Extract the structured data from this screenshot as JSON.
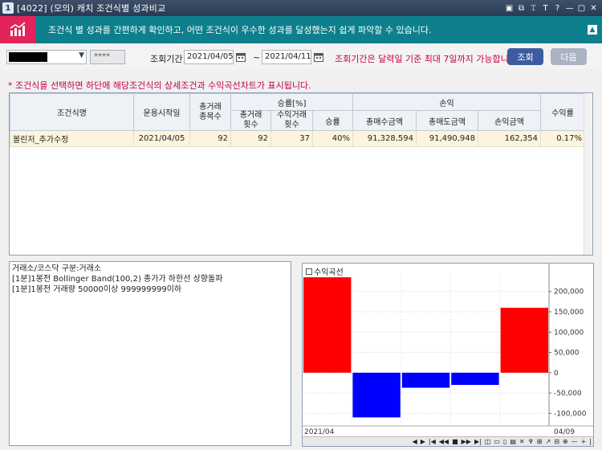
{
  "window": {
    "title": "[4022] (모의) 캐치 조건식별 성과비교",
    "controls": [
      "▣",
      "⧉",
      "𝚃",
      "T",
      "?",
      "—",
      "▢",
      "✕"
    ]
  },
  "banner": {
    "text": "조건식 별 성과를 간편하게 확인하고, 어떤 조건식이 우수한 성과를 달성했는지 쉽게 파악할 수 있습니다.",
    "collapse": "▲"
  },
  "query": {
    "account_mask": "****",
    "period_label": "조회기간",
    "start_date": "2021/04/05",
    "end_date": "2021/04/11",
    "tilde": "~",
    "notice": "조회기간은 달력일 기준 최대 7일까지 가능합니다.",
    "query_button": "조회",
    "next_button": "다음"
  },
  "info": "* 조건식을 선택하면 하단에 해당조건식의 상세조건과 수익곡선차트가 표시됩니다.",
  "table": {
    "headers": {
      "name": "조건식명",
      "start": "운용시작일",
      "traded_count": "총거래\n종목수",
      "winrate_group": "승률[%]",
      "total_trades": "총거래\n횟수",
      "profit_trades": "수익거래\n횟수",
      "winrate": "승률",
      "pnl_group": "손익",
      "buy_amt": "총매수금액",
      "sell_amt": "총매도금액",
      "pnl_amt": "손익금액",
      "return": "수익률"
    },
    "rows": [
      {
        "name": "볼린저_추가수정",
        "start": "2021/04/05",
        "traded_count": "92",
        "total_trades": "92",
        "profit_trades": "37",
        "winrate": "40%",
        "buy_amt": "91,328,594",
        "sell_amt": "91,490,948",
        "pnl_amt": "162,354",
        "return": "0.17%"
      }
    ]
  },
  "detail": {
    "lines": [
      "거래소/코스닥 구분:거래소",
      "[1분]1봉전 Bollinger Band(100,2) 종가가 하한선 상향돌파",
      "[1분]1봉전 거래량 50000이상 999999999이하"
    ]
  },
  "chart_data": {
    "type": "bar",
    "title": "수익곡선",
    "values": [
      235000,
      -110000,
      -37000,
      -30000,
      160000
    ],
    "colors": [
      "#ff0000",
      "#0000ff",
      "#0000ff",
      "#0000ff",
      "#ff0000"
    ],
    "ylim": [
      -125000,
      245000
    ],
    "yticks": [
      200000,
      150000,
      100000,
      50000,
      0,
      -50000,
      -100000
    ],
    "ytick_labels": [
      "200,000",
      "150,000",
      "100,000",
      "50,000",
      "0",
      "-50,000",
      "-100,000"
    ],
    "x_start_label": "2021/04",
    "x_end_label": "04/09",
    "grid": true,
    "toolbar": [
      "◀",
      "▶",
      "|◀",
      "◀◀",
      "■",
      "▶▶",
      "▶|",
      "◫",
      "▭",
      "▯",
      "▤",
      "✕",
      "♆",
      "⊞",
      "↗",
      "⊟",
      "⊕",
      "—",
      "+",
      "|"
    ]
  },
  "colors": {
    "banner_bg": "#0e7f8c",
    "banner_icon_bg": "#e2245a",
    "accent_red": "#c80046",
    "query_button_bg": "#3b5d9f",
    "next_button_bg": "#a9b3c2",
    "row_highlight": "#fcf4dc"
  }
}
